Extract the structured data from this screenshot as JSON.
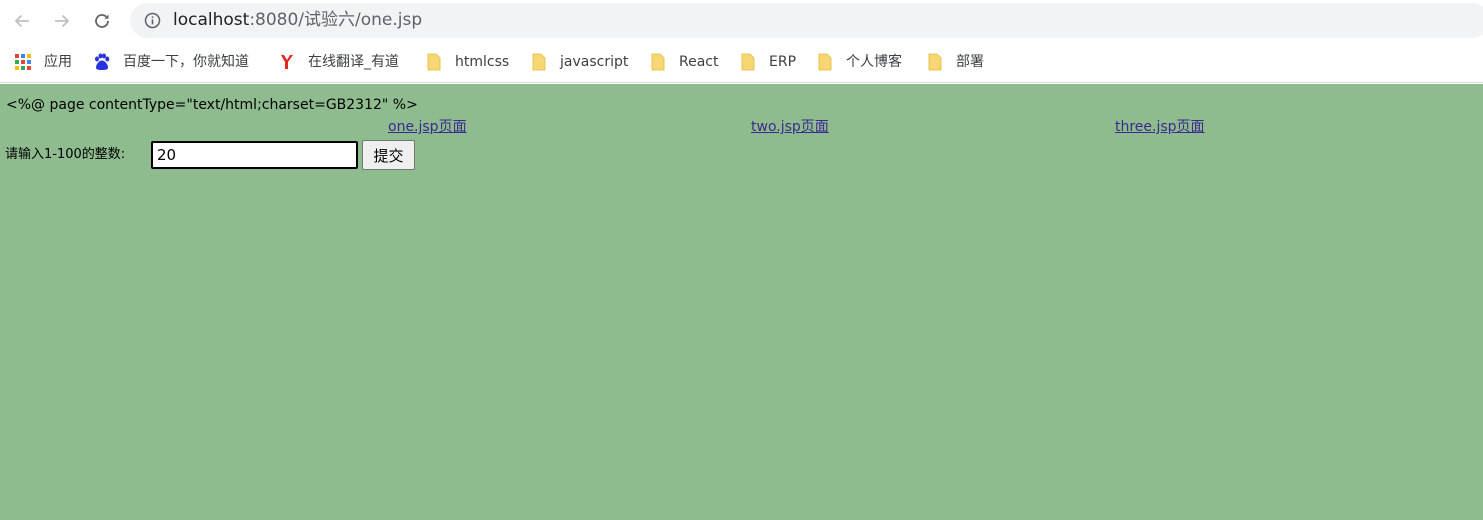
{
  "browser": {
    "url_host": "localhost",
    "url_rest": ":8080/试验六/one.jsp"
  },
  "bookmarks": [
    {
      "label": "应用",
      "icon": "apps-grid-icon"
    },
    {
      "label": "百度一下，你就知道",
      "icon": "baidu-paw-icon"
    },
    {
      "label": "在线翻译_有道",
      "icon": "youdao-icon"
    },
    {
      "label": "htmlcss",
      "icon": "folder-icon"
    },
    {
      "label": "javascript",
      "icon": "folder-icon"
    },
    {
      "label": "React",
      "icon": "folder-icon"
    },
    {
      "label": "ERP",
      "icon": "folder-icon"
    },
    {
      "label": "个人博客",
      "icon": "folder-icon"
    },
    {
      "label": "部署",
      "icon": "folder-icon"
    }
  ],
  "page": {
    "background": "#8fbc8f",
    "directive_text": "<%@ page contentType=\"text/html;charset=GB2312\" %>",
    "links": [
      "one.jsp页面",
      "two.jsp页面",
      "three.jsp页面"
    ],
    "form": {
      "prompt": "请输入1-100的整数:",
      "input_value": "20",
      "submit_label": "提交"
    }
  }
}
